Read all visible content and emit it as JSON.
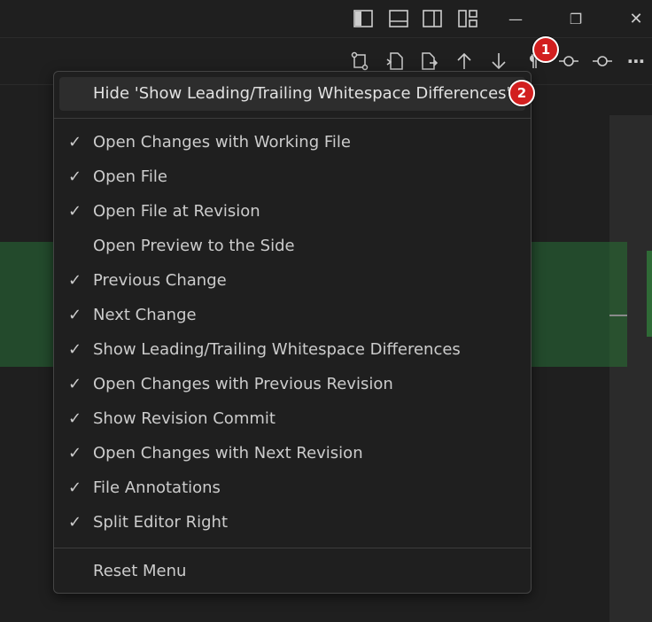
{
  "window_controls": {
    "layout_icons": [
      "toggle-primary-sidebar-icon",
      "toggle-panel-icon",
      "toggle-secondary-sidebar-icon",
      "customize-layout-icon"
    ],
    "minimize_glyph": "—",
    "restore_glyph": "❐",
    "close_glyph": "✕"
  },
  "toolbar": {
    "icons": [
      "open-changes-icon",
      "open-file-icon",
      "open-file-at-revision-icon",
      "previous-change-icon",
      "next-change-icon",
      "show-whitespace-icon",
      "show-revision-commit-icon",
      "next-revision-icon",
      "more-actions-icon"
    ],
    "more_glyph": "⋯"
  },
  "context_menu": {
    "hide_item_label": "Hide 'Show Leading/Trailing Whitespace Differences'",
    "items": [
      {
        "label": "Open Changes with Working File",
        "checked": true
      },
      {
        "label": "Open File",
        "checked": true
      },
      {
        "label": "Open File at Revision",
        "checked": true
      },
      {
        "label": "Open Preview to the Side",
        "checked": false
      },
      {
        "label": "Previous Change",
        "checked": true
      },
      {
        "label": "Next Change",
        "checked": true
      },
      {
        "label": "Show Leading/Trailing Whitespace Differences",
        "checked": true
      },
      {
        "label": "Open Changes with Previous Revision",
        "checked": true
      },
      {
        "label": "Show Revision Commit",
        "checked": true
      },
      {
        "label": "Open Changes with Next Revision",
        "checked": true
      },
      {
        "label": "File Annotations",
        "checked": true
      },
      {
        "label": "Split Editor Right",
        "checked": true
      }
    ],
    "check_glyph": "✓",
    "reset_label": "Reset Menu"
  },
  "annotations": {
    "badge_1": "1",
    "badge_2": "2"
  },
  "colors": {
    "background": "#1f1f1f",
    "menu_border": "#454545",
    "added_line_green": "#234a2c",
    "badge_red": "#d21f1f"
  }
}
